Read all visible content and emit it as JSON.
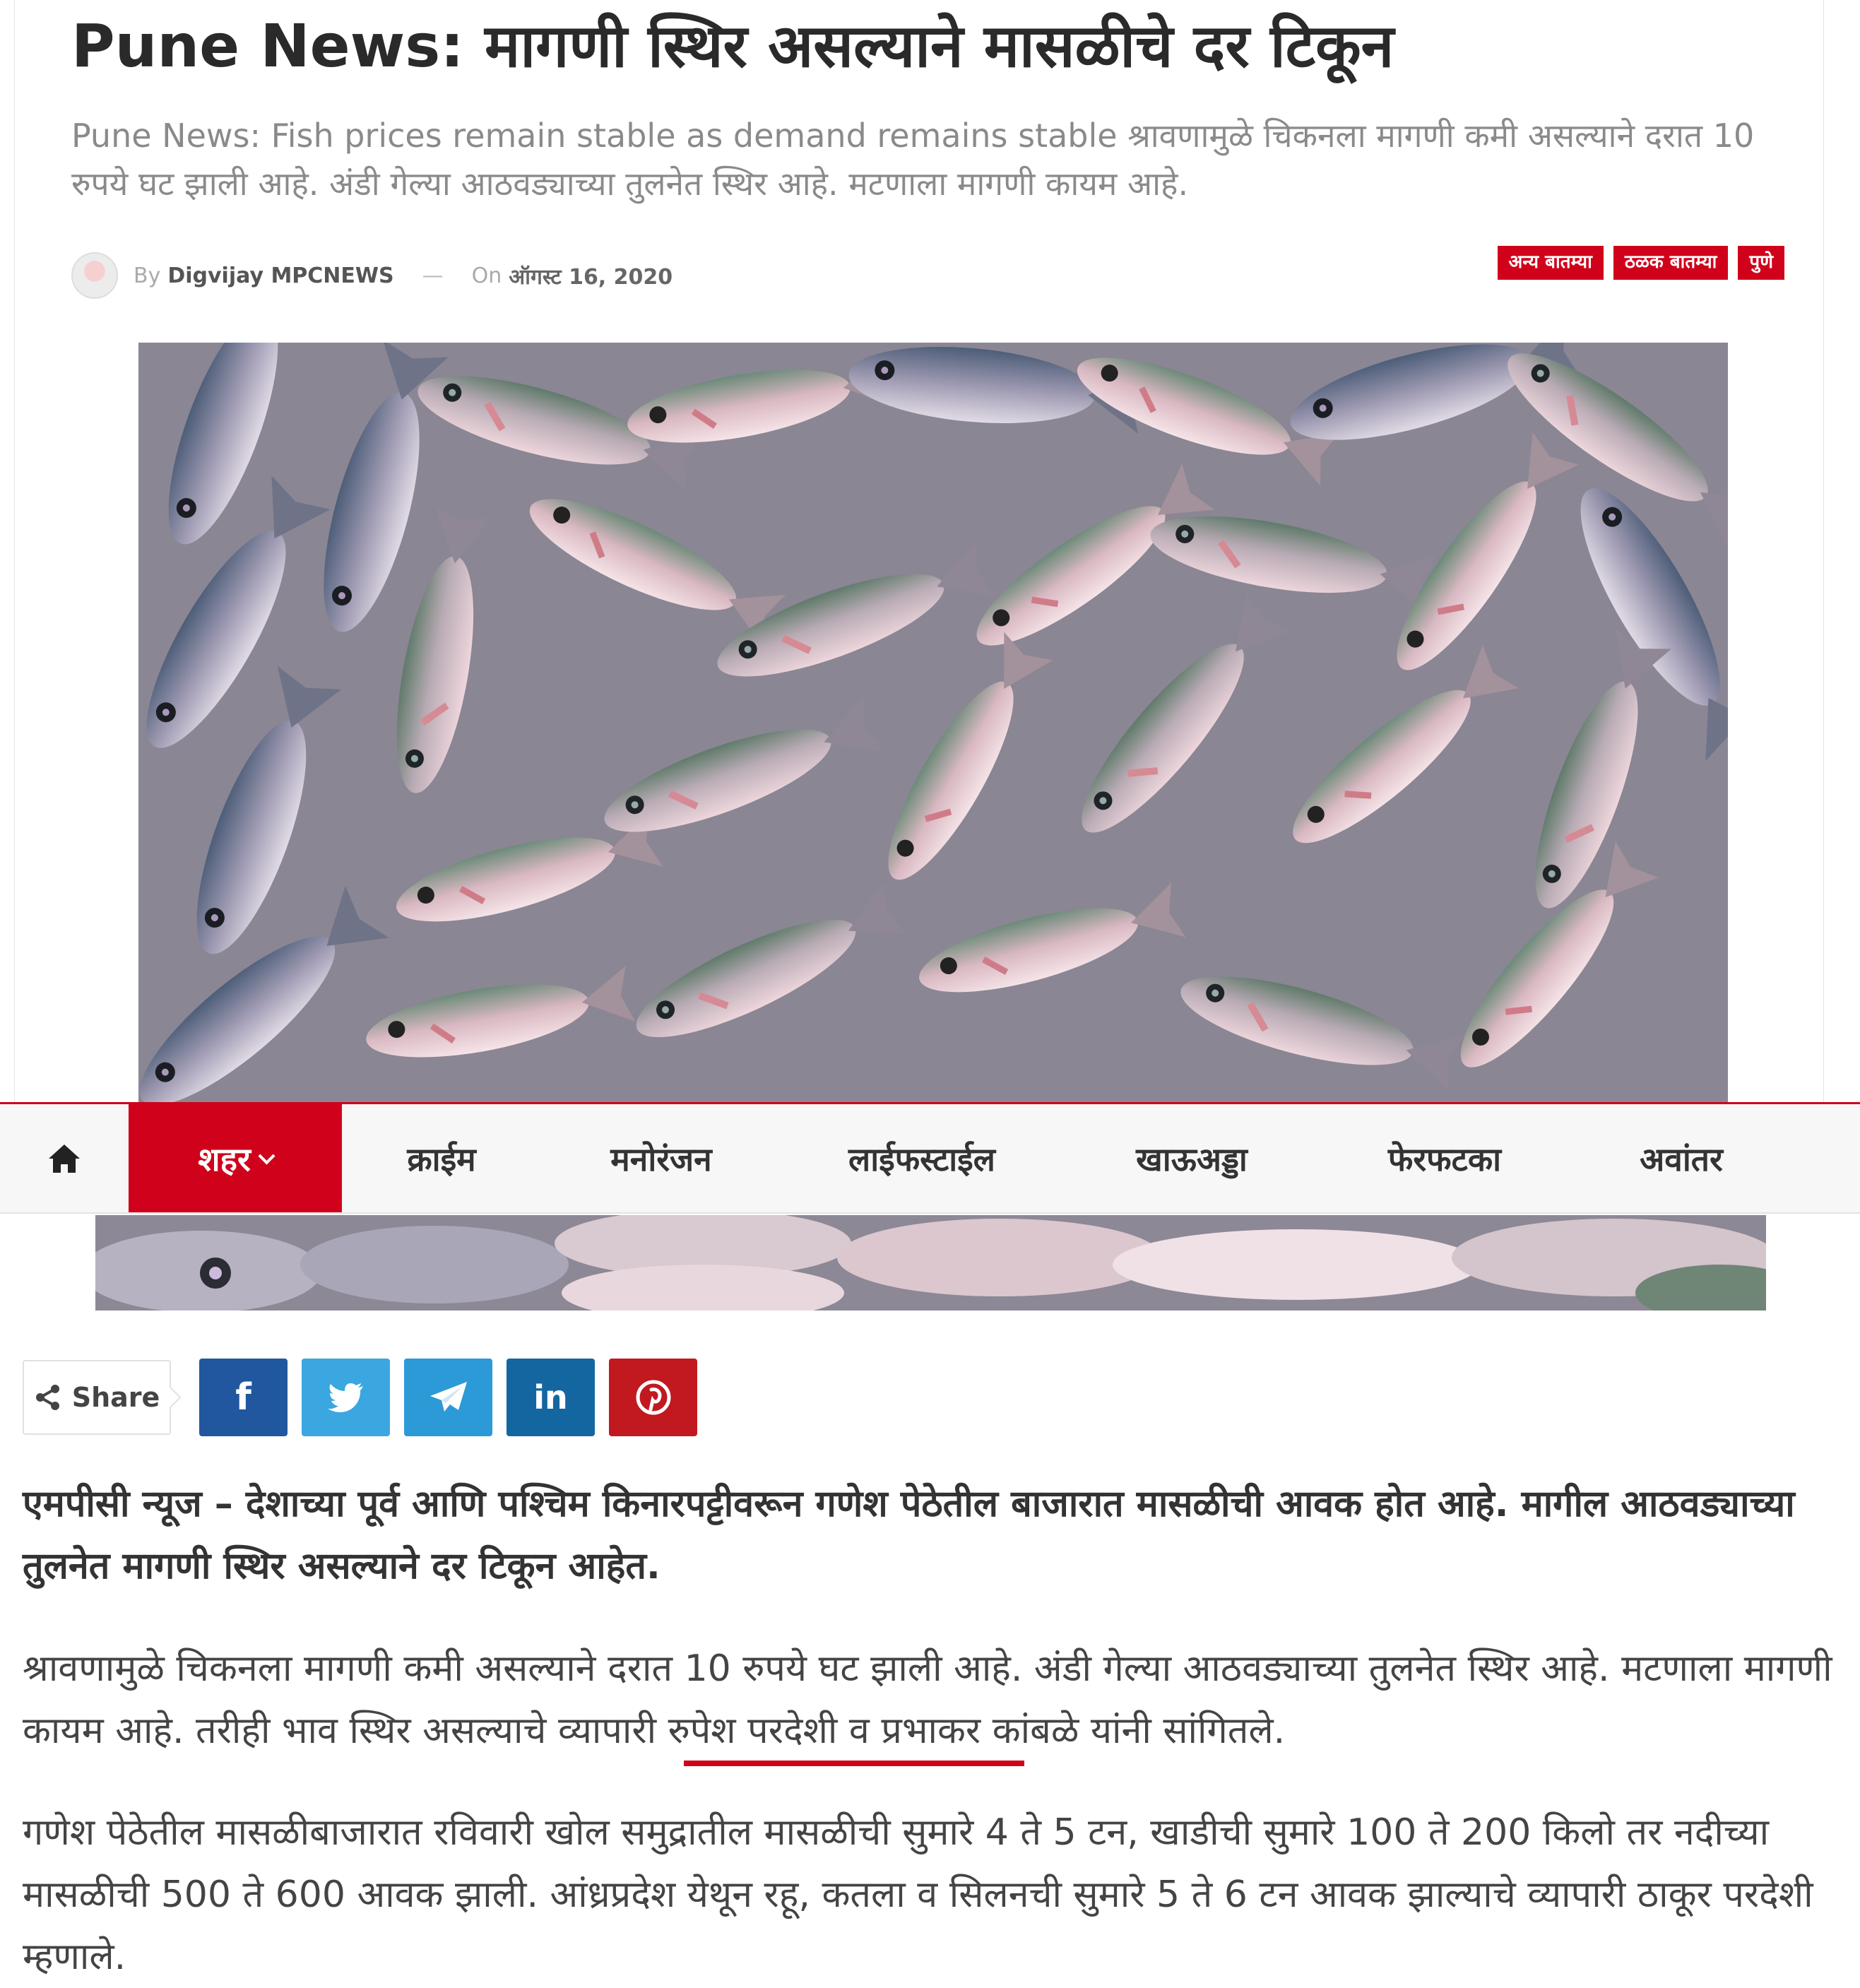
{
  "article": {
    "title": "Pune News: मागणी स्थिर असल्याने मासळीचे दर टिकून",
    "subtitle": "Pune News: Fish prices remain stable as demand remains stable श्रावणामुळे चिकनला मागणी कमी असल्याने दरात 10 रुपये घट झाली आहे. अंडी गेल्या आठवड्याच्या तुलनेत स्थिर आहे. मटणाला मागणी कायम आहे.",
    "meta": {
      "by_label": "By",
      "author": "Digvijay MPCNEWS",
      "separator": "—",
      "on_label": "On",
      "date": "ऑगस्ट 16, 2020"
    },
    "categories": [
      "अन्य बातम्या",
      "ठळक बातम्या",
      "पुणे"
    ],
    "image_icon": "fish-market-photo"
  },
  "nav": {
    "home_icon": "home-icon",
    "active": "शहर",
    "items": [
      "क्राईम",
      "मनोरंजन",
      "लाईफस्टाईल",
      "खाऊअड्डा",
      "फेरफटका",
      "अवांतर"
    ]
  },
  "share": {
    "label": "Share",
    "icon": "share-icon",
    "buttons": [
      {
        "name": "facebook",
        "glyph": "f",
        "color": "#21579e"
      },
      {
        "name": "twitter",
        "glyph": "twitter-bird",
        "color": "#3ba7e0"
      },
      {
        "name": "telegram",
        "glyph": "paper-plane",
        "color": "#2b9ad6"
      },
      {
        "name": "linkedin",
        "glyph": "in",
        "color": "#1466a1"
      },
      {
        "name": "pinterest",
        "glyph": "p",
        "color": "#c2181f"
      }
    ]
  },
  "content": {
    "lead": "एमपीसी न्यूज – देशाच्या पूर्व आणि पश्चिम किनारपट्टीवरून गणेश पेठेतील बाजारात मासळीची आवक होत आहे. मागील आठवड्याच्या तुलनेत मागणी स्थिर असल्याने दर टिकून आहेत.",
    "p2": "श्रावणामुळे चिकनला मागणी कमी असल्याने दरात 10 रुपये घट झाली आहे. अंडी गेल्या आठवड्याच्या तुलनेत स्थिर आहे. मटणाला मागणी कायम आहे. तरीही भाव स्थिर असल्याचे व्यापारी रुपेश परदेशी व प्रभाकर कांबळे यांनी सांगितले.",
    "p3": "गणेश पेठेतील मासळीबाजारात रविवारी खोल समुद्रातील मासळीची सुमारे 4 ते 5 टन, खाडीची सुमारे 100 ते 200 किलो तर नदीच्या मासळीची 500 ते 600 आवक झाली. आंध्रप्रदेश येथून रहू, कतला व सिलनची सुमारे 5 ते 6 टन आवक झाल्याचे व्यापारी ठाकूर परदेशी म्हणाले."
  },
  "colors": {
    "accent": "#d0021b",
    "nav_bg": "#f7f7f7",
    "title": "#2a2a2a",
    "subtitle": "#8a8a8a"
  }
}
